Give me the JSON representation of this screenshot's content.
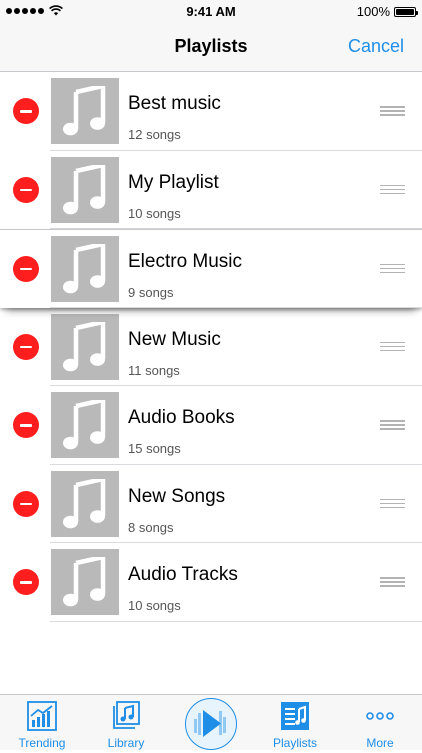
{
  "status_bar": {
    "time": "9:41 AM",
    "battery": "100%"
  },
  "nav": {
    "title": "Playlists",
    "cancel_label": "Cancel"
  },
  "playlists": [
    {
      "title": "Best music",
      "subtitle": "12 songs"
    },
    {
      "title": "My Playlist",
      "subtitle": "10 songs"
    },
    {
      "title": "Electro Music",
      "subtitle": "9 songs"
    },
    {
      "title": "New Music",
      "subtitle": "11 songs"
    },
    {
      "title": "Audio Books",
      "subtitle": "15 songs"
    },
    {
      "title": "New Songs",
      "subtitle": "8 songs"
    },
    {
      "title": "Audio Tracks",
      "subtitle": "10 songs"
    }
  ],
  "tabs": [
    {
      "label": "Trending",
      "icon": "trending-chart-icon"
    },
    {
      "label": "Library",
      "icon": "library-icon"
    },
    {
      "label": "",
      "icon": "play-icon"
    },
    {
      "label": "Playlists",
      "icon": "playlist-icon"
    },
    {
      "label": "More",
      "icon": "more-dots-icon"
    }
  ],
  "colors": {
    "accent": "#1e8ee6",
    "delete": "#fe1e1e",
    "thumb": "#b9b9b9"
  }
}
